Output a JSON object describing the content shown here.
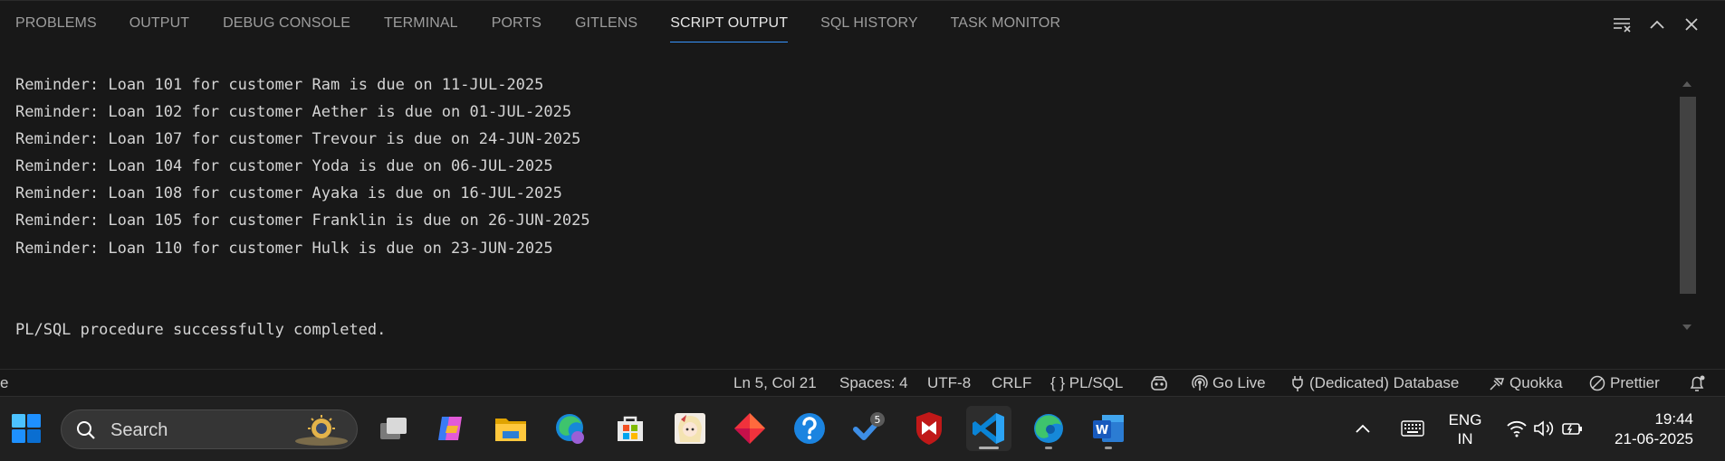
{
  "panel": {
    "tabs": [
      {
        "label": "PROBLEMS",
        "active": false
      },
      {
        "label": "OUTPUT",
        "active": false
      },
      {
        "label": "DEBUG CONSOLE",
        "active": false
      },
      {
        "label": "TERMINAL",
        "active": false
      },
      {
        "label": "PORTS",
        "active": false
      },
      {
        "label": "GITLENS",
        "active": false
      },
      {
        "label": "SCRIPT OUTPUT",
        "active": true
      },
      {
        "label": "SQL HISTORY",
        "active": false
      },
      {
        "label": "TASK MONITOR",
        "active": false
      }
    ],
    "actions": [
      "clear-output-icon",
      "maximize-panel-icon",
      "close-panel-icon"
    ],
    "output_lines": [
      "Reminder: Loan 101 for customer Ram is due on 11-JUL-2025",
      "Reminder: Loan 102 for customer Aether is due on 01-JUL-2025",
      "Reminder: Loan 107 for customer Trevour is due on 24-JUN-2025",
      "Reminder: Loan 104 for customer Yoda is due on 06-JUL-2025",
      "Reminder: Loan 108 for customer Ayaka is due on 16-JUL-2025",
      "Reminder: Loan 105 for customer Franklin is due on 26-JUN-2025",
      "Reminder: Loan 110 for customer Hulk is due on 23-JUN-2025",
      "",
      "",
      "PL/SQL procedure successfully completed."
    ]
  },
  "statusbar": {
    "left_fragment": "e",
    "cursor_position": "Ln 5, Col 21",
    "indentation": "Spaces: 4",
    "encoding": "UTF-8",
    "line_ending": "CRLF",
    "language_mode": "{ } PL/SQL",
    "go_live": "Go Live",
    "database": "(Dedicated) Database",
    "quokka": "Quokka",
    "prettier": "Prettier"
  },
  "taskbar": {
    "search_placeholder": "Search",
    "apps": [
      "task-view",
      "copilot",
      "file-explorer",
      "edge-profile",
      "microsoft-store",
      "anime-avatar-app",
      "git-app",
      "help",
      "todo",
      "mcafee",
      "vscode",
      "edge",
      "word"
    ],
    "todo_badge": "5",
    "language_line1": "ENG",
    "language_line2": "IN",
    "time": "19:44",
    "date": "21-06-2025"
  },
  "colors": {
    "panel_bg": "#181818",
    "active_tab_underline": "#3794ff",
    "taskbar_bg": "#202020"
  }
}
